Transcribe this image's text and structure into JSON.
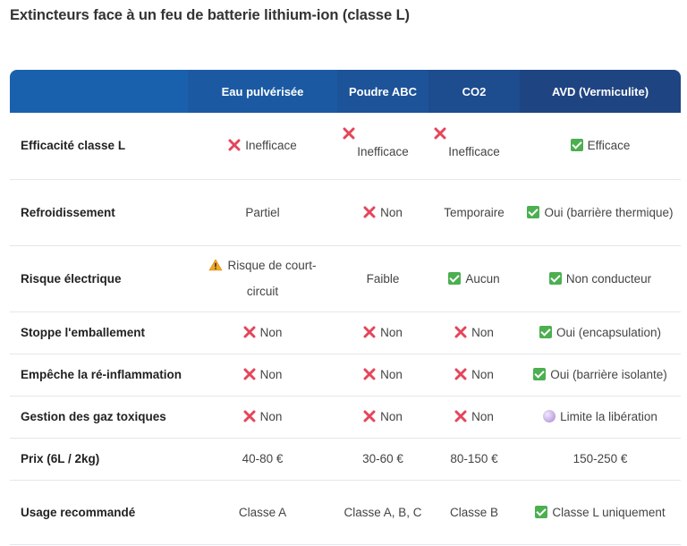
{
  "title": "Extincteurs face à un feu de batterie lithium-ion (classe L)",
  "columns": [
    "",
    "Eau pulvérisée",
    "Poudre ABC",
    "CO2",
    "AVD (Vermiculite)"
  ],
  "rows": [
    {
      "label": "Efficacité classe L",
      "cells": [
        {
          "icon": "cross",
          "text": "Inefficace"
        },
        {
          "icon": "cross",
          "text": "Inefficace"
        },
        {
          "icon": "cross",
          "text": "Inefficace"
        },
        {
          "icon": "check",
          "text": "Efficace"
        }
      ]
    },
    {
      "label": "Refroidissement",
      "cells": [
        {
          "icon": "",
          "text": "Partiel"
        },
        {
          "icon": "cross",
          "text": "Non"
        },
        {
          "icon": "",
          "text": "Temporaire"
        },
        {
          "icon": "check",
          "text": "Oui (barrière thermique)"
        }
      ]
    },
    {
      "label": "Risque électrique",
      "cells": [
        {
          "icon": "warning",
          "text": "Risque de court-circuit"
        },
        {
          "icon": "",
          "text": "Faible"
        },
        {
          "icon": "check",
          "text": "Aucun"
        },
        {
          "icon": "check",
          "text": "Non conducteur"
        }
      ]
    },
    {
      "label": "Stoppe l'emballement",
      "cells": [
        {
          "icon": "cross",
          "text": "Non"
        },
        {
          "icon": "cross",
          "text": "Non"
        },
        {
          "icon": "cross",
          "text": "Non"
        },
        {
          "icon": "check",
          "text": "Oui (encapsulation)"
        }
      ]
    },
    {
      "label": "Empêche la ré-inflammation",
      "cells": [
        {
          "icon": "cross",
          "text": "Non"
        },
        {
          "icon": "cross",
          "text": "Non"
        },
        {
          "icon": "cross",
          "text": "Non"
        },
        {
          "icon": "check",
          "text": "Oui (barrière isolante)"
        }
      ]
    },
    {
      "label": "Gestion des gaz toxiques",
      "cells": [
        {
          "icon": "cross",
          "text": "Non"
        },
        {
          "icon": "cross",
          "text": "Non"
        },
        {
          "icon": "cross",
          "text": "Non"
        },
        {
          "icon": "dot",
          "text": "Limite la libération"
        }
      ]
    },
    {
      "label": "Prix (6L / 2kg)",
      "cells": [
        {
          "icon": "",
          "text": "40-80 €"
        },
        {
          "icon": "",
          "text": "30-60 €"
        },
        {
          "icon": "",
          "text": "80-150 €"
        },
        {
          "icon": "",
          "text": "150-250 €"
        }
      ]
    },
    {
      "label": "Usage recommandé",
      "cells": [
        {
          "icon": "",
          "text": "Classe A"
        },
        {
          "icon": "",
          "text": "Classe A, B, C"
        },
        {
          "icon": "",
          "text": "Classe B"
        },
        {
          "icon": "check",
          "text": "Classe L uniquement"
        }
      ]
    }
  ],
  "colors": {
    "header_start": "#1a61ad",
    "header_end": "#1f4482",
    "cross": "#e5455a",
    "check": "#4caf50",
    "warning": "#f5a623"
  }
}
